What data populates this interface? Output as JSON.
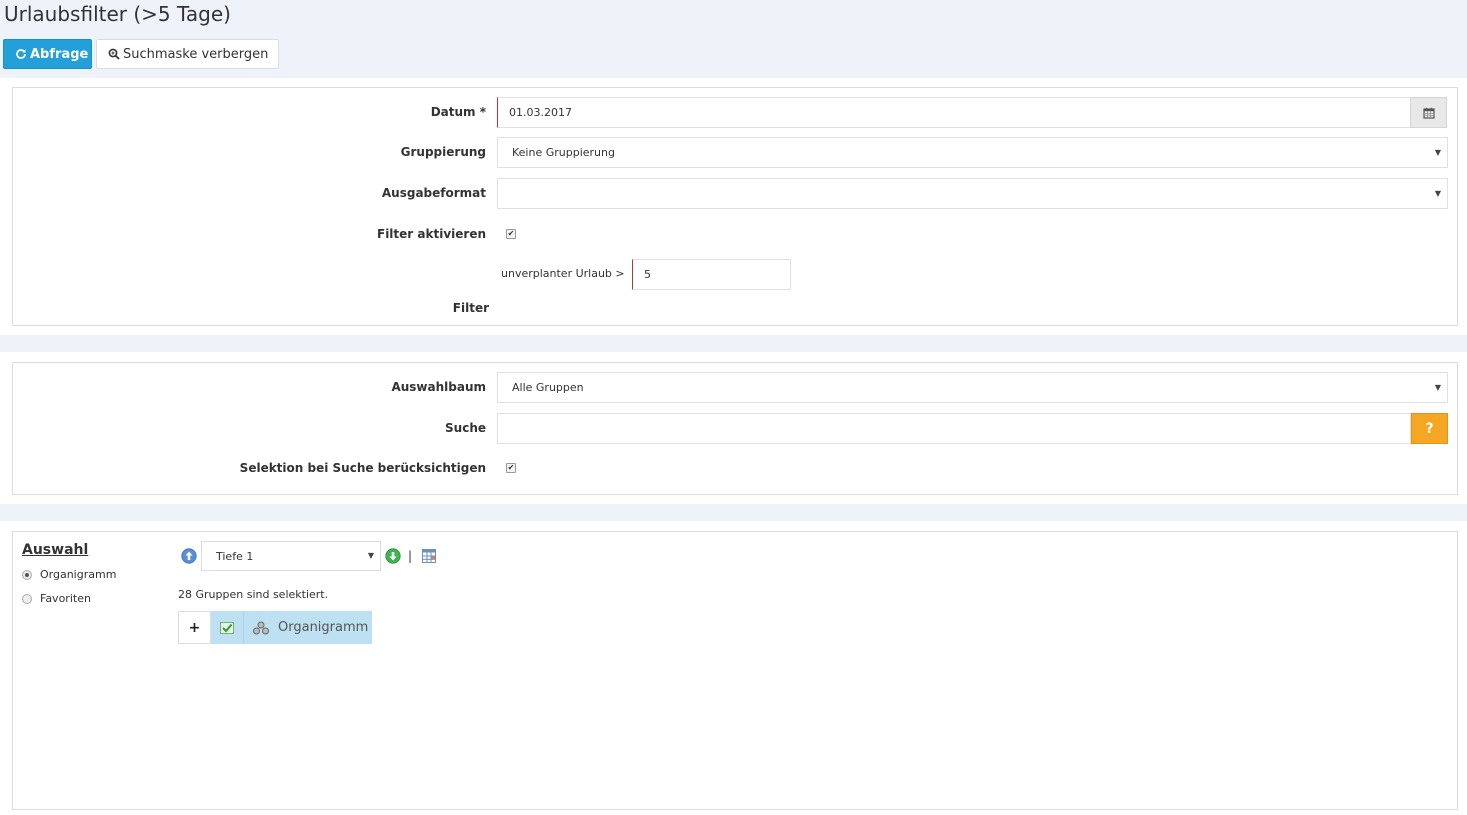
{
  "page": {
    "title": "Urlaubsfilter (>5 Tage)"
  },
  "toolbar": {
    "query_label": "Abfrage",
    "toggle_search_label": "Suchmaske verbergen"
  },
  "form1": {
    "datum_label": "Datum *",
    "datum_value": "01.03.2017",
    "gruppierung_label": "Gruppierung",
    "gruppierung_value": "Keine Gruppierung",
    "ausgabeformat_label": "Ausgabeformat",
    "ausgabeformat_value": "",
    "filter_aktivieren_label": "Filter aktivieren",
    "filter_aktivieren_checked": true,
    "unverplant_label": "unverplanter Urlaub >",
    "unverplant_value": "5",
    "filter_label": "Filter"
  },
  "form2": {
    "auswahlbaum_label": "Auswahlbaum",
    "auswahlbaum_value": "Alle Gruppen",
    "suche_label": "Suche",
    "suche_value": "",
    "help_label": "?",
    "selektion_label": "Selektion bei Suche berücksichtigen",
    "selektion_checked": true
  },
  "auswahl": {
    "title": "Auswahl",
    "options": [
      {
        "label": "Organigramm",
        "selected": true
      },
      {
        "label": "Favoriten",
        "selected": false
      }
    ],
    "depth_value": "Tiefe 1",
    "separator": "|",
    "selected_text": "28 Gruppen sind selektiert.",
    "tree": {
      "expand_label": "+",
      "node_label": "Organigramm"
    }
  },
  "colors": {
    "primary": "#23a0da",
    "help": "#f5a623",
    "tree_highlight": "#bde0f3",
    "required_border": "#bb3333",
    "background": "#eef3f9"
  },
  "icons": {
    "query": "refresh-icon",
    "toggle": "search-icon",
    "datum_addon": "calendar-icon",
    "depth_up": "arrow-up-circle-icon",
    "depth_down": "arrow-down-circle-icon",
    "grid": "grid-icon",
    "tree_check": "green-check-icon",
    "tree_node": "organigram-icon"
  }
}
